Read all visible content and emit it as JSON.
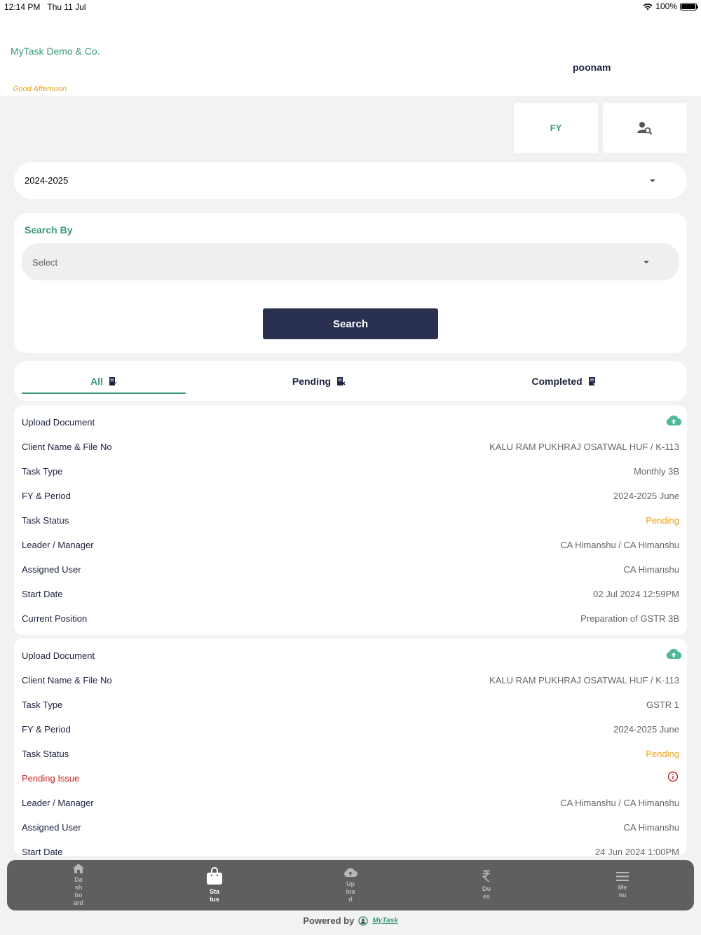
{
  "status_bar": {
    "time": "12:14 PM",
    "date": "Thu 11 Jul",
    "battery": "100%"
  },
  "header": {
    "company": "MyTask Demo & Co.",
    "user": "poonam",
    "greeting": "Good Afternoon"
  },
  "top_buttons": {
    "fy_label": "FY",
    "user_search_icon": "user-search-icon"
  },
  "fy_select": {
    "value": "2024-2025"
  },
  "search": {
    "title": "Search By",
    "placeholder": "Select",
    "button_label": "Search"
  },
  "tabs": [
    {
      "label": "All",
      "active": true
    },
    {
      "label": "Pending",
      "active": false
    },
    {
      "label": "Completed",
      "active": false
    }
  ],
  "tasks": [
    {
      "upload_label": "Upload Document",
      "rows": [
        {
          "label": "Client Name & File No",
          "value": "KALU RAM PUKHRAJ OSATWAL HUF / K-113"
        },
        {
          "label": "Task Type",
          "value": "Monthly 3B"
        },
        {
          "label": "FY & Period",
          "value": "2024-2025 June"
        },
        {
          "label": "Task Status",
          "value": "Pending"
        },
        {
          "label": "Leader / Manager",
          "value": "CA Himanshu / CA Himanshu"
        },
        {
          "label": "Assigned User",
          "value": "CA Himanshu"
        },
        {
          "label": "Start Date",
          "value": "02 Jul 2024 12:59PM"
        },
        {
          "label": "Current Position",
          "value": "Preparation of GSTR 3B"
        }
      ]
    },
    {
      "upload_label": "Upload Document",
      "pending_issue_label": "Pending Issue",
      "rows": [
        {
          "label": "Client Name & File No",
          "value": "KALU RAM PUKHRAJ OSATWAL HUF / K-113"
        },
        {
          "label": "Task Type",
          "value": "GSTR 1"
        },
        {
          "label": "FY & Period",
          "value": "2024-2025 June"
        },
        {
          "label": "Task Status",
          "value": "Pending"
        },
        {
          "label": "Leader / Manager",
          "value": "CA Himanshu / CA Himanshu"
        },
        {
          "label": "Assigned User",
          "value": "CA Himanshu"
        },
        {
          "label": "Start Date",
          "value": "24 Jun 2024 1:00PM"
        }
      ]
    }
  ],
  "nav": [
    {
      "label": "Dashboard",
      "icon": "home-icon"
    },
    {
      "label": "Status",
      "icon": "bag-icon",
      "active": true
    },
    {
      "label": "Upload",
      "icon": "cloud-upload-icon"
    },
    {
      "label": "Dues",
      "icon": "rupee-icon"
    },
    {
      "label": "Menu",
      "icon": "menu-icon"
    }
  ],
  "footer": {
    "powered_by": "Powered by",
    "logo_text": "MyTask"
  },
  "colors": {
    "accent": "#3a9a7a",
    "dark": "#2a3050",
    "pending": "#e8a317",
    "issue": "#cc2222",
    "nav_bg": "#5f5f5f"
  }
}
